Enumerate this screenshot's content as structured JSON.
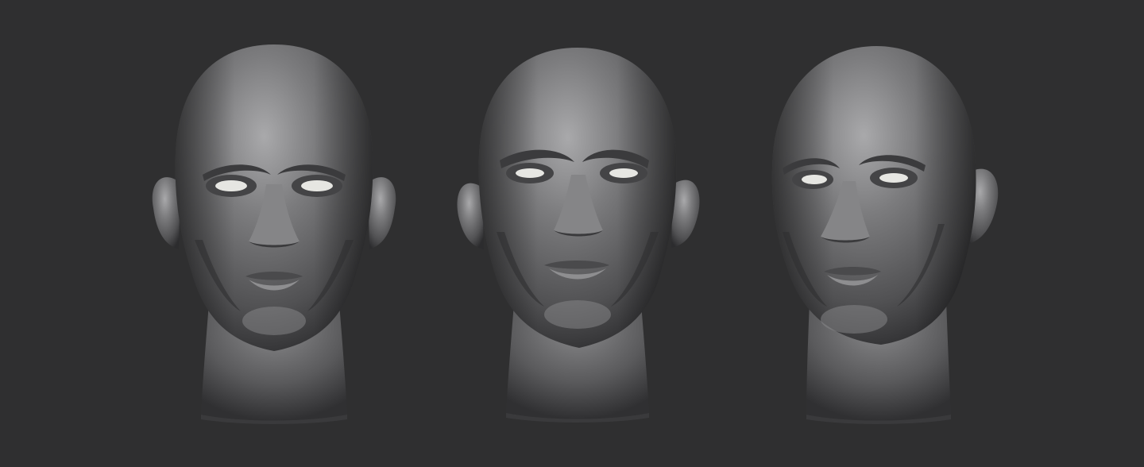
{
  "scene": {
    "background": "#2f2f30",
    "clay_base": "#6e6e70",
    "clay_highlight": "#a9a9ab",
    "clay_shadow": "#2c2c2e",
    "eye_color": "#e6e6e2"
  },
  "views": [
    {
      "name": "head-front-view",
      "view": "front"
    },
    {
      "name": "head-three-quarter-left-view",
      "view": "three-quarter-left"
    },
    {
      "name": "head-three-quarter-right-view",
      "view": "three-quarter-right"
    }
  ]
}
